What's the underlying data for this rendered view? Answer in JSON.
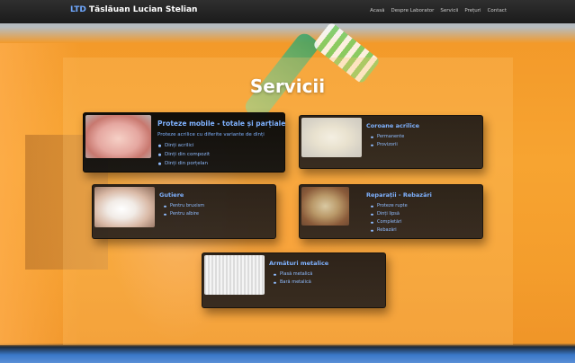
{
  "brand": {
    "prefix": "LTD",
    "name": "Tăslăuan Lucian Stelian"
  },
  "nav": [
    {
      "label": "Acasă"
    },
    {
      "label": "Despre Laborator"
    },
    {
      "label": "Servicii"
    },
    {
      "label": "Prețuri"
    },
    {
      "label": "Contact"
    }
  ],
  "page": {
    "title": "Servicii"
  },
  "cards": [
    {
      "title": "Proteze mobile - totale și parțiale",
      "description": "Proteze acrilice cu diferite variante de dinți",
      "items": [
        "Dinți acrilici",
        "Dinți din compozit",
        "Dinți din porțelan"
      ]
    },
    {
      "title": "Coroane acrilice",
      "items": [
        "Permanente",
        "Provizorii"
      ]
    },
    {
      "title": "Gutiere",
      "items": [
        "Pentru bruxism",
        "Pentru albire"
      ]
    },
    {
      "title": "Reparații - Rebazări",
      "items": [
        "Proteze rupte",
        "Dinți lipsă",
        "Completări",
        "Rebazări"
      ]
    },
    {
      "title": "Armături metalice",
      "items": [
        "Plasă metalică",
        "Bară metalică"
      ]
    }
  ]
}
